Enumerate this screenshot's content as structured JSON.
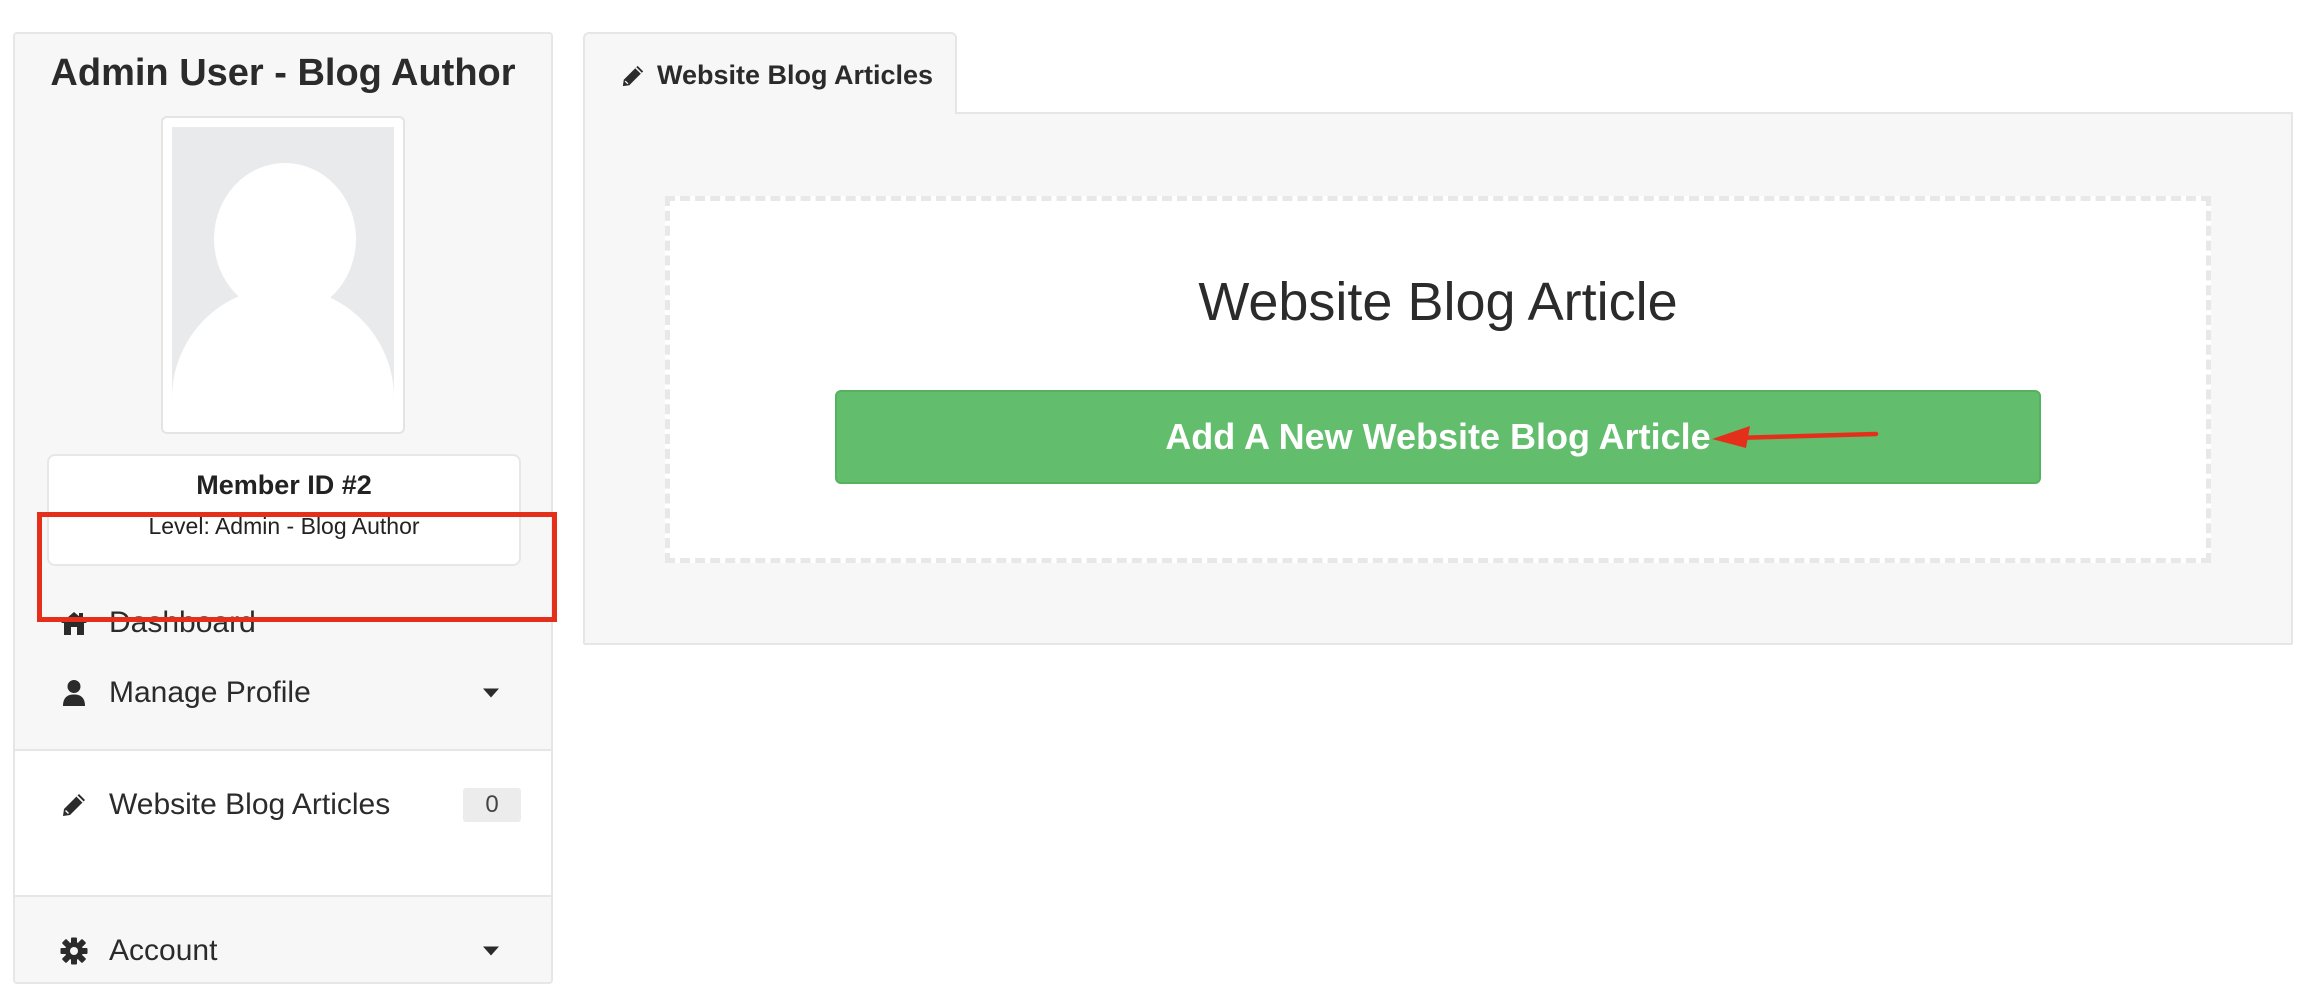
{
  "sidebar": {
    "profile_name": "Admin User - Blog Author",
    "member_id": "Member ID #2",
    "member_level": "Level: Admin - Blog Author",
    "items": [
      {
        "label": "Dashboard",
        "icon": "home-icon"
      },
      {
        "label": "Manage Profile",
        "icon": "user-icon",
        "has_dropdown": true
      },
      {
        "label": "Website Blog Articles",
        "icon": "pencil-icon",
        "badge": "0",
        "active": true
      },
      {
        "label": "Account",
        "icon": "gear-icon",
        "has_dropdown": true
      }
    ]
  },
  "main": {
    "tab_label": "Website Blog Articles",
    "heading": "Website Blog Article",
    "add_button_label": "Add A New Website Blog Article"
  },
  "colors": {
    "button_green": "#62bd6c",
    "highlight_red": "#e4301a",
    "panel_bg": "#f7f7f7"
  }
}
